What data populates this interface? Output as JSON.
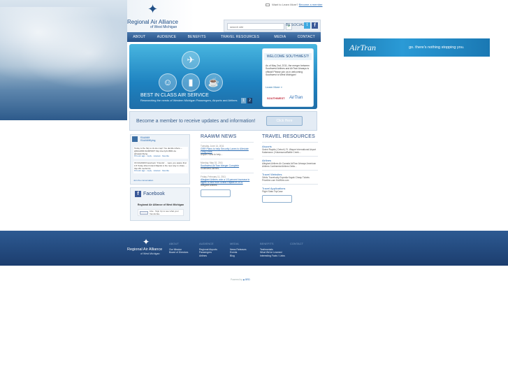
{
  "logo": {
    "line1": "Regional Air Alliance",
    "line2": "of West Michigan"
  },
  "utility": {
    "text": "Want to Learn More?",
    "link": "Become a member"
  },
  "search": {
    "placeholder": "search site",
    "social_label": "BE SOCIAL"
  },
  "nav": {
    "items": [
      "ABOUT",
      "AUDIENCE",
      "BENEFITS",
      "TRAVEL RESOURCES",
      "MEDIA",
      "CONTACT"
    ]
  },
  "hero": {
    "title": "BEST IN CLASS AIR SERVICE",
    "subtitle": "Researching the needs of Western Michigan Passengers, Airports and Airlines",
    "pages": [
      "1",
      "2"
    ],
    "promo": {
      "title": "WELCOME SOUTHWEST!",
      "body": "As of May 2nd, 2011, the merger between Southwest Airlines and AirTran Airways is official! Please join us in welcoming Southwest to West Michigan!",
      "more": "Learn More »",
      "logo1": "SOUTHWEST",
      "logo2": "AirTran"
    }
  },
  "member": {
    "text": "Become a member to receive updates and information!",
    "button": "Click Here"
  },
  "twitter": {
    "name": "RAAWM",
    "handle": "RAAWMflying",
    "tweet1": "Today is the Sky to Hi-Ho map! You decide where -- @RAAWM #AIRPORT http://ow.ly/1CB93 via @raawmflying",
    "tweet1_meta": "9 hours ago · reply · retweet · favorite",
    "tweet2": "ON RAAWM Facebook: 'Friends' ... were you aware that 1/3 Today West Grand Rapids is the new way to share ... http://fb.me/GzCk",
    "tweet2_meta": "9 hours ago · reply · retweet · favorite",
    "footer": "Join the conversation"
  },
  "facebook": {
    "title": "Facebook",
    "page_name": "Regional Air Alliance of West Michigan",
    "like_text": "Like · Sign Up to see what your friends like."
  },
  "news": {
    "title": "RAAWM NEWS",
    "entries": [
      {
        "date": "Tuesday, June 14, 2011",
        "link": "GRR Plans to help Security Lanes to Alleviate Long Lines",
        "excerpt": "Airport Plans to help..."
      },
      {
        "date": "Monday, May 02, 2011",
        "link": "Southwest-AirTran Merger Complete",
        "excerpt": "Southwest Airlines..."
      },
      {
        "date": "Friday, February 11, 2011",
        "link": "Allegiant Airlines vote a 1/3 percent increase in flights to and from Grand Rapids in 2011",
        "excerpt": "Allegiant Airlines..."
      }
    ]
  },
  "travel": {
    "title": "TRAVEL RESOURCES",
    "sections": [
      {
        "heading": "Airports",
        "body": "Grand Rapids | Detroit | Ft. Wayne International Airport Kalamazoo | Kalamazoo/Battle Creek..."
      },
      {
        "heading": "Airlines",
        "body": "Allegiant Airlines Air Canada AirTran Airways American Airlines Continental Airlines Delta..."
      },
      {
        "heading": "Travel Websites",
        "body": "Orbitz Travelocity Expedia Kayak Cheap Tickets Priceline.com HotWire.com"
      },
      {
        "heading": "Travel Applications",
        "body": "Flight Stats TripCase"
      }
    ]
  },
  "footer": {
    "logo1": "Regional Air Alliance",
    "logo2": "of West Michigan",
    "cols": [
      {
        "head": "ABOUT",
        "links": [
          "Our Mission",
          "Board of Directors"
        ]
      },
      {
        "head": "AUDIENCE",
        "links": [
          "Regional Airports",
          "Passengers",
          "Airlines"
        ]
      },
      {
        "head": "MEDIA",
        "links": [
          "News Releases",
          "Events",
          "Blog"
        ]
      },
      {
        "head": "BENEFITS",
        "links": [
          "Testimonials",
          "What We've Learned",
          "Interesting Facts / Links"
        ]
      },
      {
        "head": "CONTACT",
        "links": []
      }
    ],
    "powered": "Powered by",
    "powered_brand": "◆ BRD"
  },
  "ad": {
    "logo": "AirTran",
    "tagline": "go. there's nothing stopping you."
  }
}
